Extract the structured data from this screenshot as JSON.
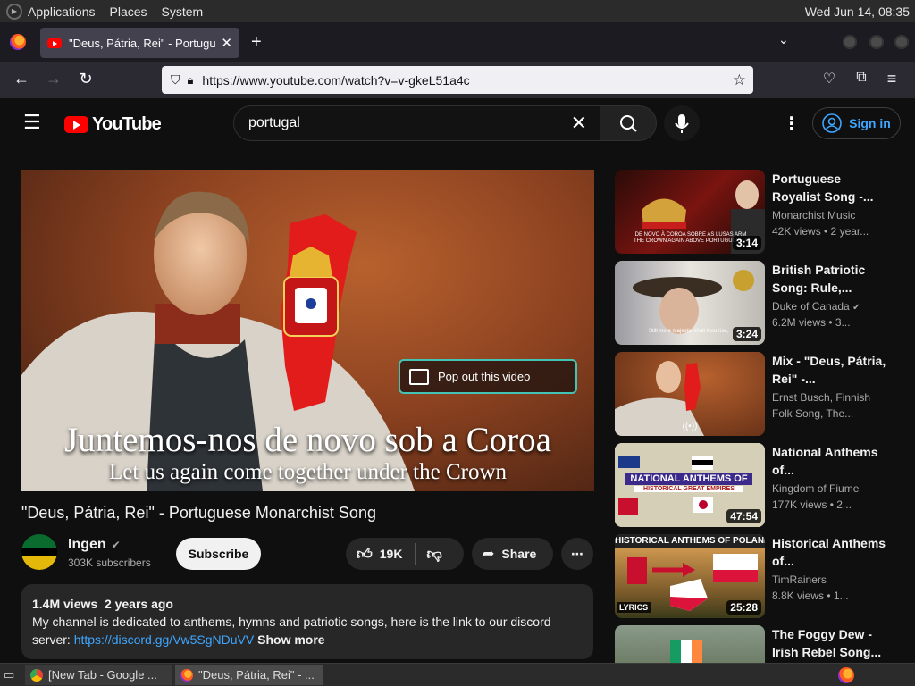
{
  "os_panel": {
    "menus": [
      "Applications",
      "Places",
      "System"
    ],
    "clock": "Wed Jun 14, 08:35"
  },
  "browser": {
    "tab_title": "\"Deus, Pátria, Rei\" - Portugu",
    "url": "https://www.youtube.com/watch?v=v-gkeL51a4c"
  },
  "youtube": {
    "logo_text": "YouTube",
    "search_value": "portugal",
    "sign_in": "Sign in"
  },
  "player": {
    "popout_label": "Pop out this video",
    "caption_pt": "Juntemos-nos de novo sob a Coroa",
    "caption_en": "Let us again come together under the Crown"
  },
  "video": {
    "title": "\"Deus, Pátria, Rei\" - Portuguese Monarchist Song",
    "channel": "Ingen",
    "subscribers": "303K subscribers",
    "subscribe": "Subscribe",
    "likes": "19K",
    "share": "Share",
    "views": "1.4M views",
    "age": "2 years ago",
    "description": "My channel is dedicated to anthems, hymns and patriotic songs, here is the link to our discord server:",
    "discord_link": "https://discord.gg/Vw5SgNDuVV",
    "show_more": "Show more"
  },
  "recommendations": [
    {
      "title": "Portuguese Royalist Song -...",
      "channel": "Monarchist Music",
      "meta": "42K views  • 2 year...",
      "duration": "3:14",
      "thumb_text": "DE NOVO À COROA SOBRE AS LUSAS ARM THE CROWN AGAIN ABOVE PORTUGUESE A"
    },
    {
      "title": "British Patriotic Song: Rule,...",
      "channel": "Duke of Canada",
      "meta": "6.2M views  • 3...",
      "duration": "3:24",
      "thumb_text": "Still more majestic shalt thou rise,"
    },
    {
      "title": "Mix - \"Deus, Pátria, Rei\" -...",
      "channel": "Ernst Busch, Finnish",
      "meta": "Folk Song, The...",
      "duration": "",
      "thumb_text": ""
    },
    {
      "title": "National Anthems of...",
      "channel": "Kingdom of Fiume",
      "meta": "177K views  • 2...",
      "duration": "47:54",
      "thumb_text": "NATIONAL ANTHEMS OF",
      "thumb_sub": "HISTORICAL GREAT EMPIRES"
    },
    {
      "title": "Historical Anthems of...",
      "channel": "TimRainers",
      "meta": "8.8K views  • 1...",
      "duration": "25:28",
      "thumb_text": "HISTORICAL ANTHEMS OF POLAND",
      "thumb_sub": "LYRICS"
    },
    {
      "title": "The Foggy Dew - Irish Rebel Song...",
      "channel": "",
      "meta": "",
      "duration": "",
      "thumb_text": ""
    }
  ],
  "taskbar": {
    "tasks": [
      "[New Tab - Google ...",
      "\"Deus, Pátria, Rei\" - ..."
    ]
  }
}
